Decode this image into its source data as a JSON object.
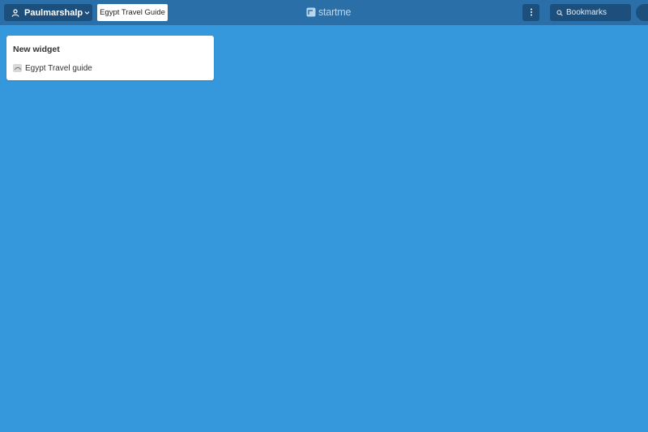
{
  "header": {
    "user_name": "Paulmarshalp",
    "page_tab_label": "Egypt Travel Guide",
    "logo_text": "startme",
    "search_label": "Bookmarks"
  },
  "widget": {
    "title": "New widget",
    "bookmarks": [
      {
        "label": "Egypt Travel guide",
        "icon": "favicon-icon"
      }
    ]
  },
  "colors": {
    "background": "#3698dc",
    "topbar": "#2a6fa8",
    "button": "#1c4f7c",
    "widget": "#ffffff"
  }
}
